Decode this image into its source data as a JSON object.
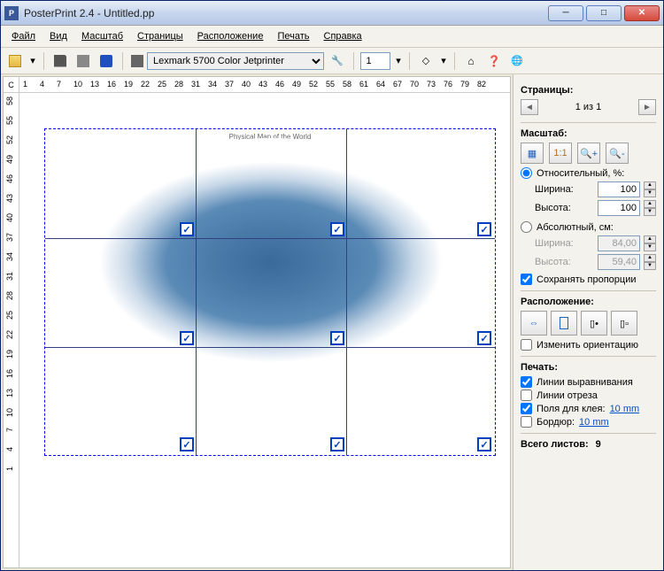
{
  "window": {
    "title": "PosterPrint 2.4 - Untitled.pp"
  },
  "menu": {
    "file": "Файл",
    "view": "Вид",
    "zoom": "Масштаб",
    "pages": "Страницы",
    "layout": "Расположение",
    "print": "Печать",
    "help": "Справка"
  },
  "toolbar": {
    "printer": "Lexmark 5700 Color Jetprinter",
    "page": "1"
  },
  "ruler": {
    "corner": "C",
    "h": [
      "1",
      "4",
      "7",
      "10",
      "13",
      "16",
      "19",
      "22",
      "25",
      "28",
      "31",
      "34",
      "37",
      "40",
      "43",
      "46",
      "49",
      "52",
      "55",
      "58",
      "61",
      "64",
      "67",
      "70",
      "73",
      "76",
      "79",
      "82"
    ],
    "v": [
      "1",
      "4",
      "7",
      "10",
      "13",
      "16",
      "19",
      "22",
      "25",
      "28",
      "31",
      "34",
      "37",
      "40",
      "43",
      "46",
      "49",
      "52",
      "55",
      "58"
    ]
  },
  "canvasLabel": "Physical Map of the World",
  "side": {
    "pages": {
      "title": "Страницы:",
      "text": "1 из 1"
    },
    "zoom": {
      "title": "Масштаб:"
    },
    "rel": {
      "label": "Относительный, %:",
      "width_lbl": "Ширина:",
      "height_lbl": "Высота:",
      "width": "100",
      "height": "100"
    },
    "abs": {
      "label": "Абсолютный, см:",
      "width_lbl": "Ширина:",
      "height_lbl": "Высота:",
      "width": "84,00",
      "height": "59,40"
    },
    "keep": "Сохранять пропорции",
    "layout": {
      "title": "Расположение:",
      "rotate": "Изменить ориентацию"
    },
    "print": {
      "title": "Печать:",
      "align": "Линии выравнивания",
      "cut": "Линии отреза",
      "glue": "Поля для клея:",
      "glue_val": "10 mm",
      "border": "Бордюр:",
      "border_val": "10 mm"
    },
    "total": {
      "lbl": "Всего листов:",
      "val": "9"
    }
  }
}
